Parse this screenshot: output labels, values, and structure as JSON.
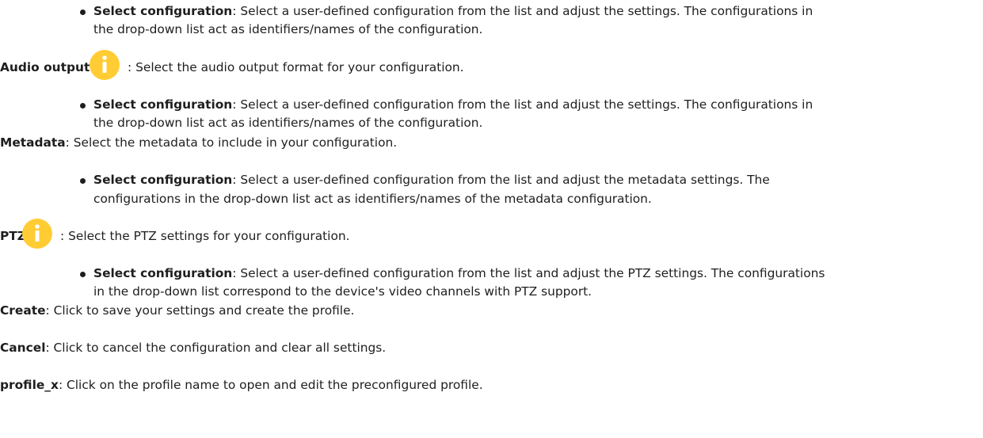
{
  "sections": [
    {
      "label": "Audio output",
      "description": ": Select the audio output format for your configuration.",
      "has_info_icon": true
    },
    {
      "label": "Metadata",
      "description": ": Select the metadata to include in your configuration."
    },
    {
      "label": "PTZ",
      "description": ": Select the PTZ settings for your configuration.",
      "has_info_icon": true
    }
  ],
  "bullets": [
    {
      "term": "Select configuration",
      "line1": ": Select a user-defined configuration from the list and adjust the settings. The configurations in",
      "line2": "the drop-down list act as identifiers/names of the configuration."
    },
    {
      "term": "Select configuration",
      "line1": ": Select a user-defined configuration from the list and adjust the settings. The configurations in",
      "line2": "the drop-down list act as identifiers/names of the configuration."
    },
    {
      "term": "Select configuration",
      "line1": ": Select a user-defined configuration from the list and adjust the metadata settings. The",
      "line2": "configurations in the drop-down list act as identifiers/names of the metadata configuration."
    },
    {
      "term": "Select configuration",
      "line1": ": Select a user-defined configuration from the list and adjust the PTZ settings. The configurations",
      "line2": "in the drop-down list correspond to the device's video channels with PTZ support."
    }
  ],
  "actions": [
    {
      "term": "Create",
      "description": ": Click to save your settings and create the profile."
    },
    {
      "term": "Cancel",
      "description": ": Click to cancel the configuration and clear all settings."
    },
    {
      "term": "profile_x",
      "description": ": Click on the profile name to open and edit the preconfigured profile."
    }
  ],
  "colors": {
    "info_icon": "#ffcc33",
    "text": "#1e1e1e"
  },
  "icons": {
    "info": "info-icon"
  }
}
